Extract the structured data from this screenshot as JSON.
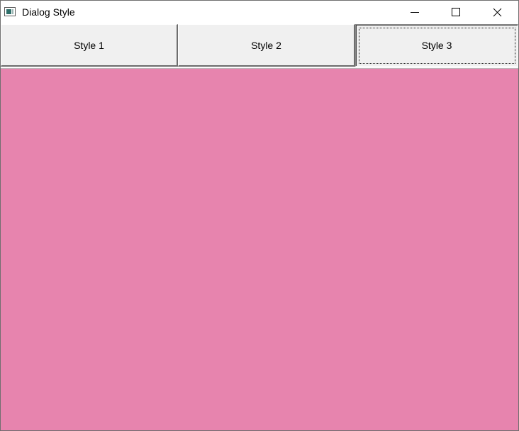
{
  "window": {
    "title": "Dialog Style",
    "icon": "app-window-icon",
    "controls": {
      "minimize_icon": "minimize-icon",
      "maximize_icon": "maximize-icon",
      "close_icon": "close-icon"
    }
  },
  "toolbar": {
    "buttons": [
      {
        "label": "Style 1"
      },
      {
        "label": "Style 2"
      },
      {
        "label": "Style 3",
        "focused": true
      }
    ]
  },
  "content": {
    "background_color": "#e784ae"
  },
  "colors": {
    "titlebar": "#ffffff",
    "button_face": "#f0f0f0",
    "content": "#e784ae"
  }
}
